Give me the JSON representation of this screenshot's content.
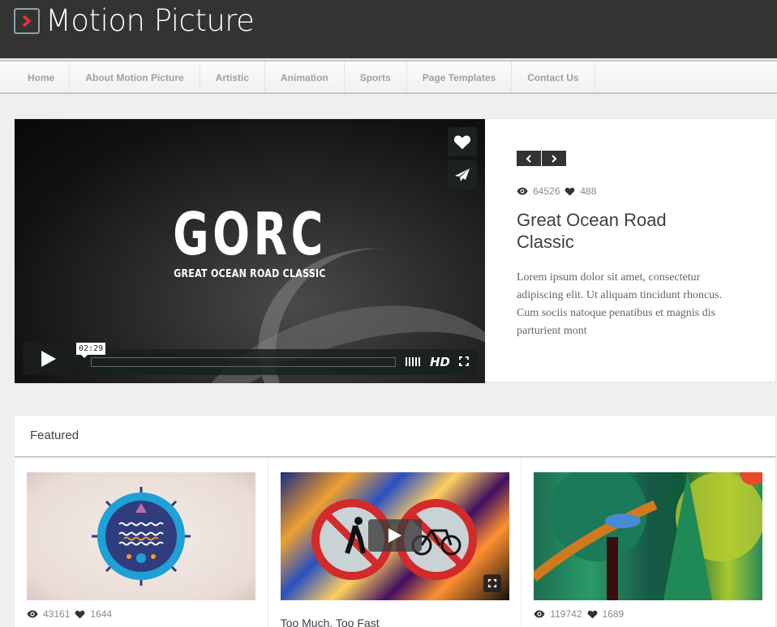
{
  "site": {
    "title": "Motion Picture",
    "accent_color": "#e8323c"
  },
  "nav": {
    "items": [
      {
        "label": "Home"
      },
      {
        "label": "About Motion Picture"
      },
      {
        "label": "Artistic"
      },
      {
        "label": "Animation"
      },
      {
        "label": "Sports"
      },
      {
        "label": "Page Templates"
      },
      {
        "label": "Contact Us"
      }
    ]
  },
  "hero": {
    "video": {
      "overlay_title": "GORC",
      "overlay_subtitle": "GREAT OCEAN ROAD CLASSIC",
      "time_tooltip": "02:29",
      "quality_label": "HD",
      "icons": [
        "heart-icon",
        "send-icon",
        "play-icon",
        "volume-icon",
        "fullscreen-icon"
      ]
    },
    "views": "64526",
    "likes": "488",
    "title": "Great Ocean Road Classic",
    "description": "Lorem ipsum dolor sit amet, consectetur adipiscing elit. Ut aliquam tincidunt rhoncus. Cum sociis natoque penatibus et magnis dis parturient mont",
    "prev_icon": "chevron-left-icon",
    "next_icon": "chevron-right-icon"
  },
  "featured": {
    "heading": "Featured",
    "cards": [
      {
        "views": "43161",
        "likes": "1644"
      },
      {
        "title": "Too Much, Too Fast"
      },
      {
        "views": "119742",
        "likes": "1689"
      }
    ]
  }
}
